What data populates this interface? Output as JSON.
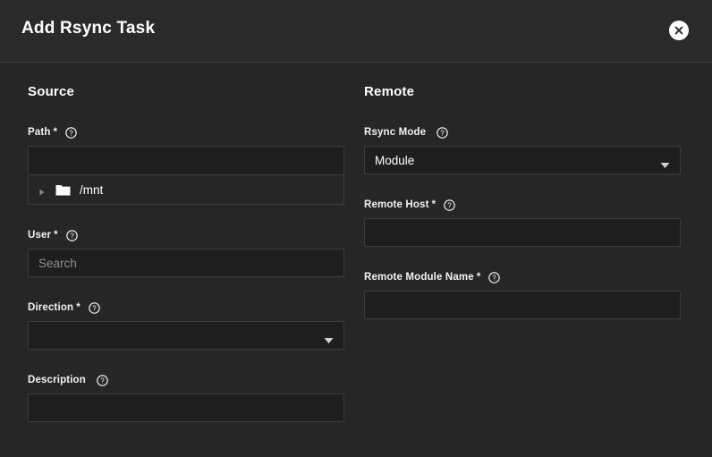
{
  "header": {
    "title": "Add Rsync Task",
    "close_icon": "close-circle-icon"
  },
  "colors": {
    "background": "#262626",
    "header_background": "#2a2a2a",
    "divider": "#3a3a3a",
    "input_background": "#1e1e1e",
    "input_border": "#3d3d3d",
    "text": "#ffffff",
    "placeholder": "#8e8e8e",
    "folder_icon": "#fdfdf7",
    "caret": "#8a8a8a"
  },
  "source": {
    "heading": "Source",
    "path": {
      "label": "Path",
      "required_marker": "*",
      "help_icon": "help-circle-icon",
      "value": "",
      "placeholder": "",
      "tree": [
        {
          "caret_icon": "caret-right-icon",
          "folder_icon": "folder-icon",
          "label": "/mnt"
        }
      ]
    },
    "user": {
      "label": "User",
      "required_marker": "*",
      "help_icon": "help-circle-icon",
      "value": "",
      "placeholder": "Search"
    },
    "direction": {
      "label": "Direction",
      "required_marker": "*",
      "help_icon": "help-circle-icon",
      "selected": "",
      "arrow_icon": "chevron-down-icon"
    },
    "description": {
      "label": "Description",
      "required_marker": "",
      "help_icon": "help-circle-icon",
      "value": "",
      "placeholder": ""
    }
  },
  "remote": {
    "heading": "Remote",
    "rsync_mode": {
      "label": "Rsync Mode",
      "required_marker": "",
      "help_icon": "help-circle-icon",
      "selected": "Module",
      "arrow_icon": "chevron-down-icon"
    },
    "remote_host": {
      "label": "Remote Host",
      "required_marker": "*",
      "help_icon": "help-circle-icon",
      "value": "",
      "placeholder": ""
    },
    "remote_module_name": {
      "label": "Remote Module Name",
      "required_marker": "*",
      "help_icon": "help-circle-icon",
      "value": "",
      "placeholder": ""
    }
  }
}
